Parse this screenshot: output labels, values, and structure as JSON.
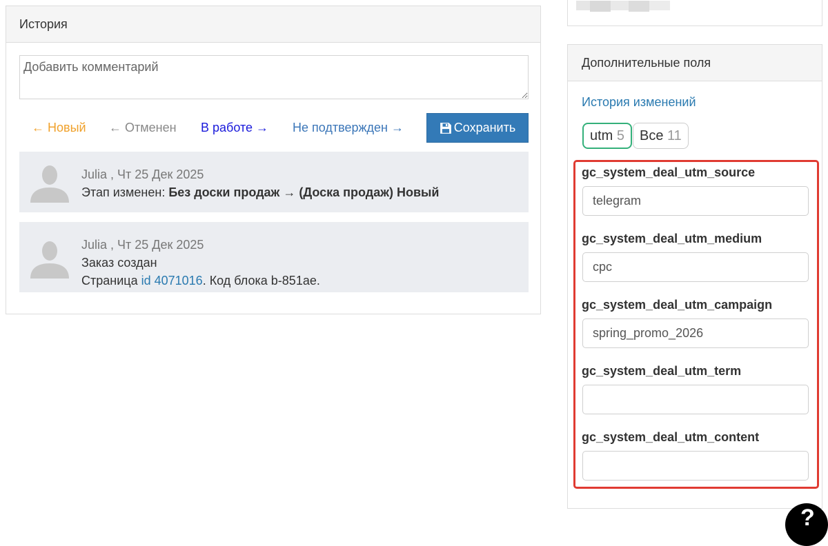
{
  "history": {
    "title": "История",
    "comment_placeholder": "Добавить комментарий",
    "statuses": {
      "new": "← Новый",
      "cancelled": "← Отменен",
      "in_work": "В работе →",
      "unconfirmed": "Не подтвержден →"
    },
    "save_label": "Сохранить",
    "entries": [
      {
        "author": "Julia",
        "separator": " , ",
        "date": "Чт 25 Дек 2025",
        "line1_prefix": "Этап изменен: ",
        "line1_bold": "Без доски продаж → (Доска продаж) Новый"
      },
      {
        "author": "Julia",
        "separator": " , ",
        "date": "Чт 25 Дек 2025",
        "line1": "Заказ создан",
        "line2_prefix": "Страница ",
        "line2_link": "id 4071016",
        "line2_suffix": ". Код блока b-851ae."
      }
    ]
  },
  "extra_fields": {
    "title": "Дополнительные поля",
    "history_link": "История изменений",
    "tags": [
      {
        "label": "utm",
        "count": "5"
      },
      {
        "label": "Все",
        "count": "11"
      }
    ],
    "fields": [
      {
        "label": "gc_system_deal_utm_source",
        "value": "telegram"
      },
      {
        "label": "gc_system_deal_utm_medium",
        "value": "cpc"
      },
      {
        "label": "gc_system_deal_utm_campaign",
        "value": "spring_promo_2026"
      },
      {
        "label": "gc_system_deal_utm_term",
        "value": ""
      },
      {
        "label": "gc_system_deal_utm_content",
        "value": ""
      }
    ]
  },
  "colors": {
    "primary_button": "#337ab7",
    "highlight_border": "#e03b32",
    "active_tag_border": "#33b07a",
    "link": "#2a7ab0",
    "status_new": "#f0a12b"
  }
}
